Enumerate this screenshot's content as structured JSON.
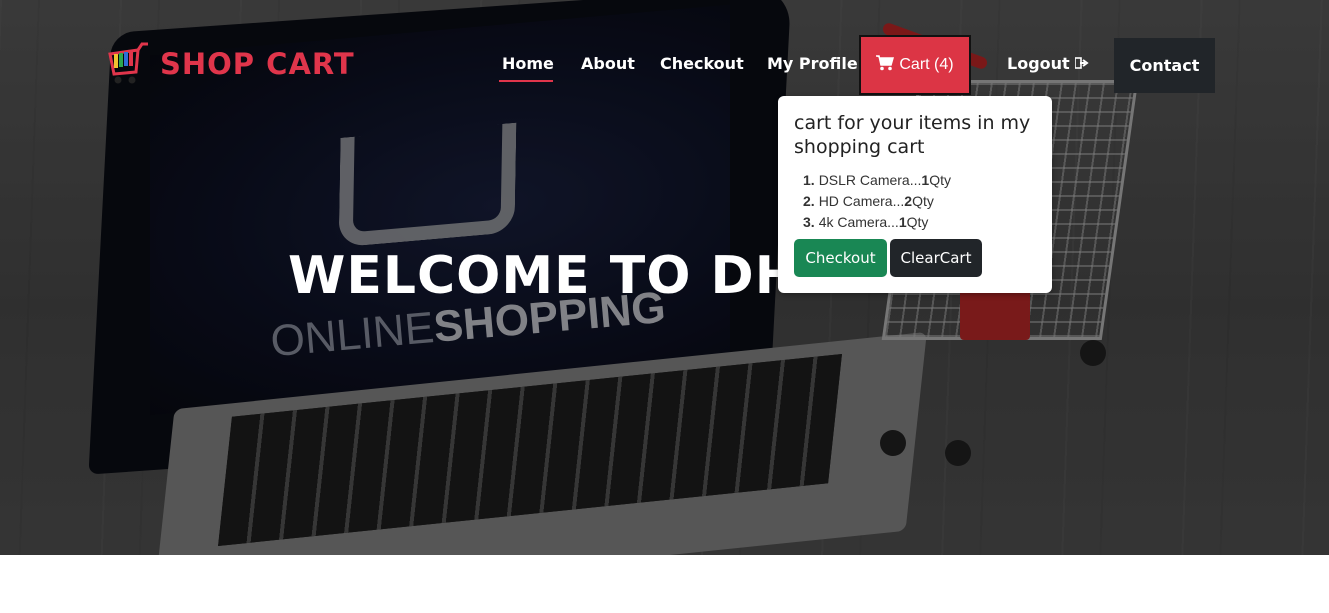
{
  "brand": {
    "name": "SHOP CART",
    "logo_icon": "shopping-cart-logo-icon",
    "color": "#e0354b"
  },
  "nav": {
    "home": "Home",
    "about": "About",
    "checkout": "Checkout",
    "profile": "My Profile",
    "cart_label": "Cart (4)",
    "cart_icon": "cart-icon",
    "logout": "Logout",
    "logout_icon": "sign-out-icon",
    "contact": "Contact"
  },
  "cart_popover": {
    "title": "cart for your items in my shopping cart",
    "items": [
      {
        "num": "1.",
        "name": "DSLR Camera...",
        "qty": "1",
        "unit": "Qty"
      },
      {
        "num": "2.",
        "name": "HD Camera...",
        "qty": "2",
        "unit": "Qty"
      },
      {
        "num": "3.",
        "name": "4k Camera...",
        "qty": "1",
        "unit": "Qty"
      }
    ],
    "checkout_label": "Checkout",
    "clear_label": "ClearCart"
  },
  "hero": {
    "welcome_text": "WELCOME TO DHAM",
    "screen_text_light": "ONLINE",
    "screen_text_bold": "SHOPPING"
  },
  "colors": {
    "accent": "#dc3545",
    "success": "#198754",
    "dark": "#212529"
  }
}
